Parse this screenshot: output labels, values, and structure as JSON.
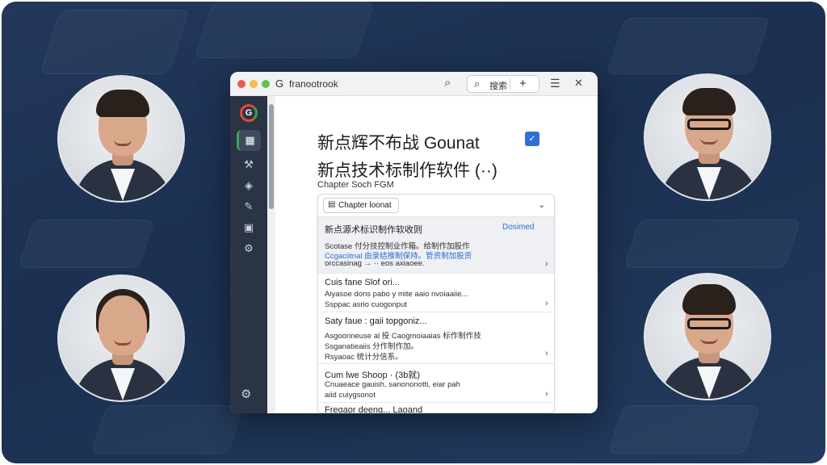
{
  "app": {
    "title": "franootrook",
    "logo_letter": "G"
  },
  "titlebar": {
    "pill_text": "搜索",
    "plus": "+"
  },
  "icons": {
    "search": "⌕",
    "plus": "+",
    "list": "☰",
    "close": "✕",
    "check": "✓",
    "grid": "▦",
    "settings": "⚙",
    "chevron": "›",
    "doc": "▤",
    "collapse": "⌄"
  },
  "sidebar": {
    "items": [
      {
        "icon": "▦",
        "name": "grid-icon"
      },
      {
        "icon": "⚒",
        "name": "tools-icon"
      },
      {
        "icon": "◈",
        "name": "shield-icon"
      },
      {
        "icon": "✎",
        "name": "edit-icon"
      },
      {
        "icon": "▣",
        "name": "save-icon"
      },
      {
        "icon": "⚙",
        "name": "gear-icon"
      }
    ]
  },
  "main": {
    "heading_1": "新点辉不布战 Gounat",
    "heading_2": "新点技术标制作软件 (··)",
    "sublabel": "Chapter  Soch FGM"
  },
  "panel": {
    "chapter_button": "Chapter  loonat",
    "rows": [
      {
        "title": "新点源术标识制作软收则",
        "status": "Dosimed",
        "lines": [
          "Scotase 付分技控制业作箱。给制作加股作",
          "Ccgaciitnal 由录结推制保持。管资制加股资",
          "orccasinag → ·· eos axiaoee."
        ]
      },
      {
        "title": "Cuis fane  Slof ori...",
        "lines": [
          "Aiyasoe dons pabo y mite aaio nvoiaaiie...",
          "Ssppac asrio cuogonput"
        ]
      },
      {
        "title": "Saty faue : gaii topgoniz...",
        "lines": [
          "Asgoorineuse al 投 Caogmoiaaias 标作制作技",
          "Ssganatieaiis 分作制作加。",
          "Rsyaoac 统计分信系。"
        ]
      },
      {
        "title": "Cum lwe Shoop · (3b就)",
        "lines": [
          "Cnuaeace gauish, sanononotti, eiar pah",
          "aiid cuiygsonot"
        ]
      },
      {
        "title": "Freqaor deeng...   Laoand"
      }
    ]
  }
}
